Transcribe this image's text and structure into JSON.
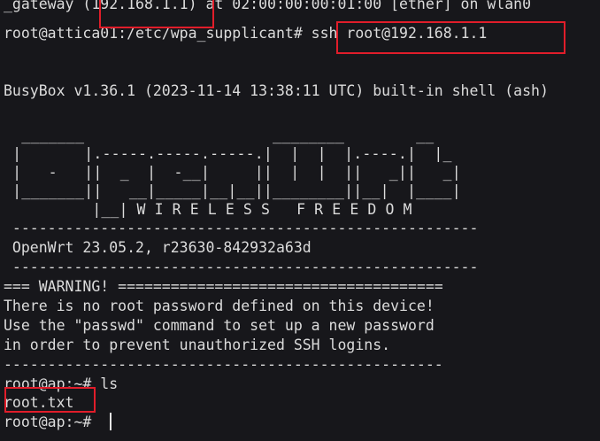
{
  "terminal": {
    "lines": [
      "_gateway (192.168.1.1) at 02:00:00:00:01:00 [ether] on wlan0",
      "root@attica01:/etc/wpa_supplicant# ssh root@192.168.1.1",
      "",
      "",
      "BusyBox v1.36.1 (2023-11-14 13:38:11 UTC) built-in shell (ash)"
    ],
    "logo": [
      "  _______                     ________        __",
      " |       |.-----.-----.-----.|  |  |  |.----.|  |_",
      " |   -   ||  _  |  -__|     ||  |  |  ||   _||   _|",
      " |_______||   __|_____|__|__||________||__|  |____|",
      "          |__| W I R E L E S S   F R E E D O M"
    ],
    "divider": " -----------------------------------------------------",
    "version": " OpenWrt 23.05.2, r23630-842932a63d",
    "warning": [
      "=== WARNING! =====================================",
      "There is no root password defined on this device!",
      "Use the \"passwd\" command to set up a new password",
      "in order to prevent unauthorized SSH logins.",
      "--------------------------------------------------"
    ],
    "ls_command": "root@ap:~# ls",
    "ls_output": "root.txt",
    "prompt": "root@ap:~# "
  },
  "colors": {
    "background": "#17171b",
    "text": "#dcdcdc",
    "highlight": "#e11d2a"
  }
}
